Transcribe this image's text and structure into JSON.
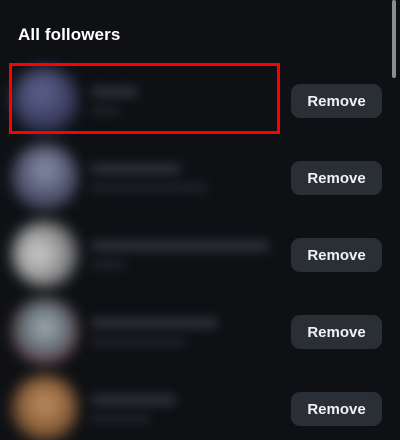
{
  "header": {
    "title": "All followers"
  },
  "followers": [
    {
      "remove_label": "Remove",
      "avatar_color": "#4a4f7a"
    },
    {
      "remove_label": "Remove",
      "avatar_color": "#6b7290"
    },
    {
      "remove_label": "Remove",
      "avatar_color": "#bcbcbc"
    },
    {
      "remove_label": "Remove",
      "avatar_color": "#7a8a92"
    },
    {
      "remove_label": "Remove",
      "avatar_color": "#a9774a"
    }
  ],
  "colors": {
    "background": "#0e1014",
    "button_bg": "#2a2e35",
    "highlight": "#ff0000",
    "text": "#ffffff"
  }
}
